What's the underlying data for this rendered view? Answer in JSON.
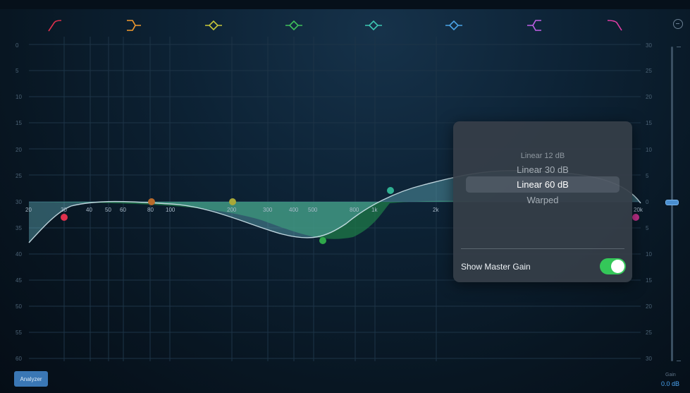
{
  "band_icons": [
    {
      "name": "high-pass-filter-icon",
      "color": "#e0314d"
    },
    {
      "name": "low-shelf-icon",
      "color": "#f29a2e"
    },
    {
      "name": "bell-eq-icon",
      "color": "#c8c83a"
    },
    {
      "name": "bell-eq-icon",
      "color": "#3fc05a"
    },
    {
      "name": "bell-eq-icon",
      "color": "#3dc7b3"
    },
    {
      "name": "bell-eq-icon",
      "color": "#4aa3e6"
    },
    {
      "name": "high-shelf-icon",
      "color": "#c160e6"
    },
    {
      "name": "low-pass-filter-icon",
      "color": "#e23ea7"
    }
  ],
  "analyzer_scale": [
    "0",
    "5",
    "10",
    "15",
    "20",
    "25",
    "30",
    "35",
    "40",
    "45",
    "50",
    "55",
    "60"
  ],
  "gain_scale": [
    "30",
    "25",
    "20",
    "15",
    "10",
    "5",
    "0",
    "5",
    "10",
    "15",
    "20",
    "25",
    "30"
  ],
  "frequency_labels": [
    "20",
    "30",
    "40",
    "50",
    "60",
    "80",
    "100",
    "200",
    "300",
    "400",
    "500",
    "800",
    "1k",
    "2k",
    "20k"
  ],
  "analyzer_button": "Analyzer",
  "popover": {
    "options": [
      "Linear 12 dB",
      "Linear 30 dB",
      "Linear 60 dB",
      "Warped"
    ],
    "selected": "Linear 60 dB",
    "master_gain_label": "Show Master Gain",
    "master_gain_on": true
  },
  "master_gain": {
    "title": "Gain",
    "value": "0.0 dB"
  },
  "colors": {
    "accent": "#4aa3f0",
    "toggle_on": "#34c759",
    "curve_fill": "#6fc3cf"
  }
}
